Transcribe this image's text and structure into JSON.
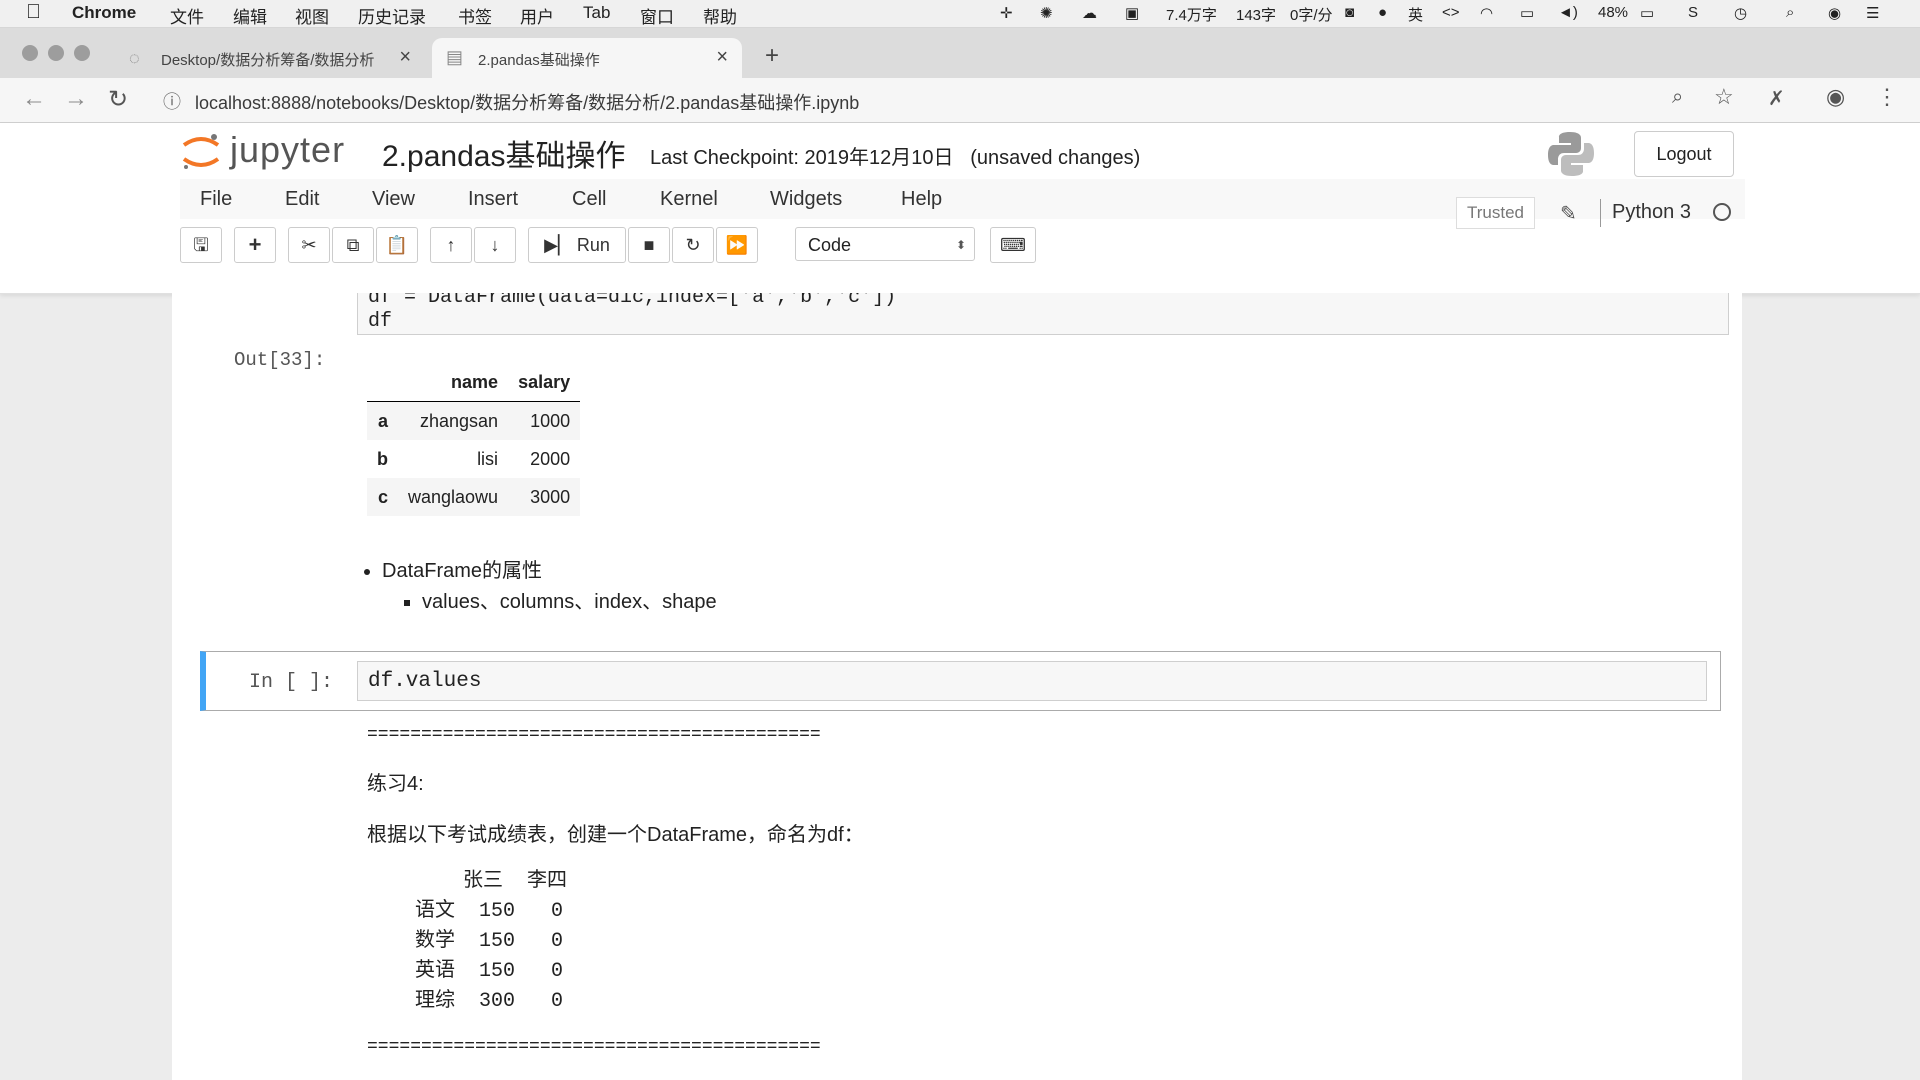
{
  "os_menubar": {
    "app": "Chrome",
    "items": [
      "文件",
      "编辑",
      "视图",
      "历史记录",
      "书签",
      "用户",
      "Tab",
      "窗口",
      "帮助"
    ],
    "status": [
      "7.4万字",
      "143字",
      "0字/分",
      "48%"
    ]
  },
  "browser": {
    "tabs": [
      {
        "title": "Desktop/数据分析筹备/数据分析"
      },
      {
        "title": "2.pandas基础操作"
      }
    ],
    "url": "localhost:8888/notebooks/Desktop/数据分析筹备/数据分析/2.pandas基础操作.ipynb"
  },
  "jupyter": {
    "logo": "jupyter",
    "notebook_name": "2.pandas基础操作",
    "checkpoint": "Last Checkpoint: 2019年12月10日",
    "unsaved": "(unsaved changes)",
    "logout": "Logout",
    "menus": [
      "File",
      "Edit",
      "View",
      "Insert",
      "Cell",
      "Kernel",
      "Widgets",
      "Help"
    ],
    "trusted": "Trusted",
    "kernel": "Python 3",
    "toolbar": {
      "run": "Run",
      "cell_type": "Code"
    }
  },
  "notebook": {
    "prev_code": [
      "df = DataFrame(data=dic,index=['a','b','c'])",
      "df"
    ],
    "out_prompt": "Out[33]:",
    "table": {
      "columns": [
        "name",
        "salary"
      ],
      "rows": [
        {
          "index": "a",
          "name": "zhangsan",
          "salary": "1000"
        },
        {
          "index": "b",
          "name": "lisi",
          "salary": "2000"
        },
        {
          "index": "c",
          "name": "wanglaowu",
          "salary": "3000"
        }
      ]
    },
    "bullet": "DataFrame的属性",
    "subbullet": "values、columns、index、shape",
    "in_prompt": "In [ ]:",
    "active_code": "df.values",
    "separator": "==========================================",
    "exercise_title": "练习4:",
    "exercise_desc": "根据以下考试成绩表，创建一个DataFrame，命名为df：",
    "score_header": "        张三  李四",
    "score_rows": [
      "    语文  150   0",
      "    数学  150   0",
      "    英语  150   0",
      "    理综  300   0"
    ]
  }
}
